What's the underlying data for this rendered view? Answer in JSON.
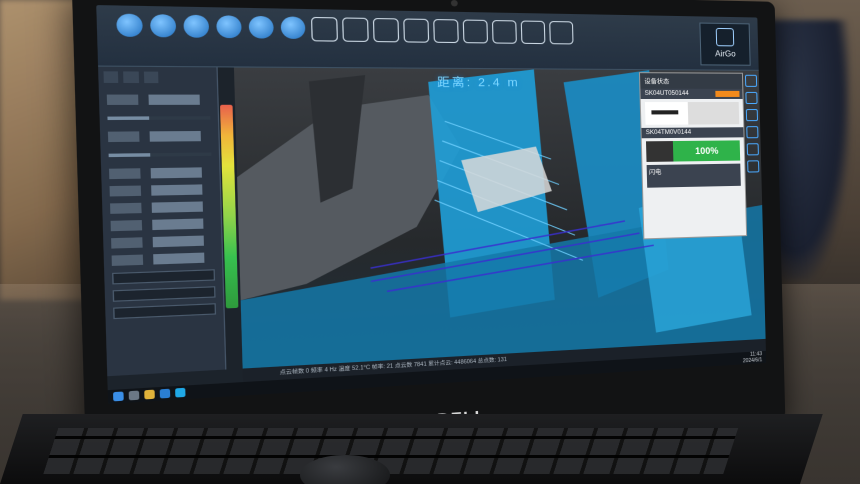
{
  "colors": {
    "accent_blue": "#1fa9e8",
    "scan_cyan": "#2fb0e6",
    "battery_green": "#2fb34a",
    "status_orange": "#f28a1c",
    "toolbar_bg": "#263343"
  },
  "brand": "DELL",
  "toolbar": {
    "airgo_label": "AirGo",
    "buttons": [
      {
        "icon": "circle-tool-icon"
      },
      {
        "icon": "circle-tool-icon"
      },
      {
        "icon": "circle-tool-icon"
      },
      {
        "icon": "circle-tool-icon"
      },
      {
        "icon": "circle-tool-icon"
      },
      {
        "icon": "circle-tool-icon"
      },
      {
        "icon": "box-tool-icon"
      },
      {
        "icon": "box-tool-icon"
      },
      {
        "icon": "box-tool-icon"
      },
      {
        "icon": "box-tool-icon"
      },
      {
        "icon": "box-tool-icon"
      },
      {
        "icon": "cube-tool-icon"
      },
      {
        "icon": "cube-tool-icon"
      },
      {
        "icon": "cube-tool-icon"
      },
      {
        "icon": "cube-tool-icon"
      }
    ]
  },
  "viewport": {
    "distance_readout": "距离: 2.4 m"
  },
  "device_panel": {
    "title": "设备状态",
    "device_sn": "SK04UT050144",
    "scanner_sn": "SK04TM0V0144",
    "battery_percent": "100%",
    "battery_value": 1.0,
    "footer_label": "闪电"
  },
  "status_bar": {
    "text": "点云帧数 0  频率 4 Hz  温度 52.1°C          帧率: 21  点云数 7841  累计点云: 4486064  总点数: 131"
  },
  "taskbar": {
    "time": "11:43",
    "date": "2024/6/1"
  }
}
